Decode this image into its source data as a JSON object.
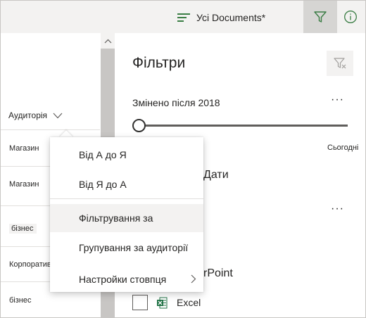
{
  "commandbar": {
    "view_label": "Усі Documents*",
    "filter_icon": "filter-icon",
    "info_icon": "info-icon"
  },
  "list": {
    "column_header": "Аудиторія",
    "rows": [
      {
        "value": "Магазин"
      },
      {
        "value": "Магазин"
      },
      {
        "value": "бізнес"
      },
      {
        "value": "Корпоративна"
      },
      {
        "value": "бізнес"
      }
    ]
  },
  "filters_panel": {
    "title": "Фільтри",
    "modified_section": {
      "title": "Змінено після 2018",
      "slider_end_label": "Сьогодні",
      "slider_value": 0
    },
    "dates_label": "Дати",
    "file_type_partial": "rPoint",
    "excel_label": "Excel"
  },
  "context_menu": {
    "items": [
      {
        "label": "Від А до Я"
      },
      {
        "label": "Від Я до А"
      },
      {
        "label": "Фільтрування за"
      },
      {
        "label": "Групування за аудиторії"
      },
      {
        "label": "Настройки стовпця"
      }
    ]
  },
  "colors": {
    "accent_green": "#3a7d44",
    "excel_green": "#217346",
    "selected_bg": "#d6d5d3"
  }
}
